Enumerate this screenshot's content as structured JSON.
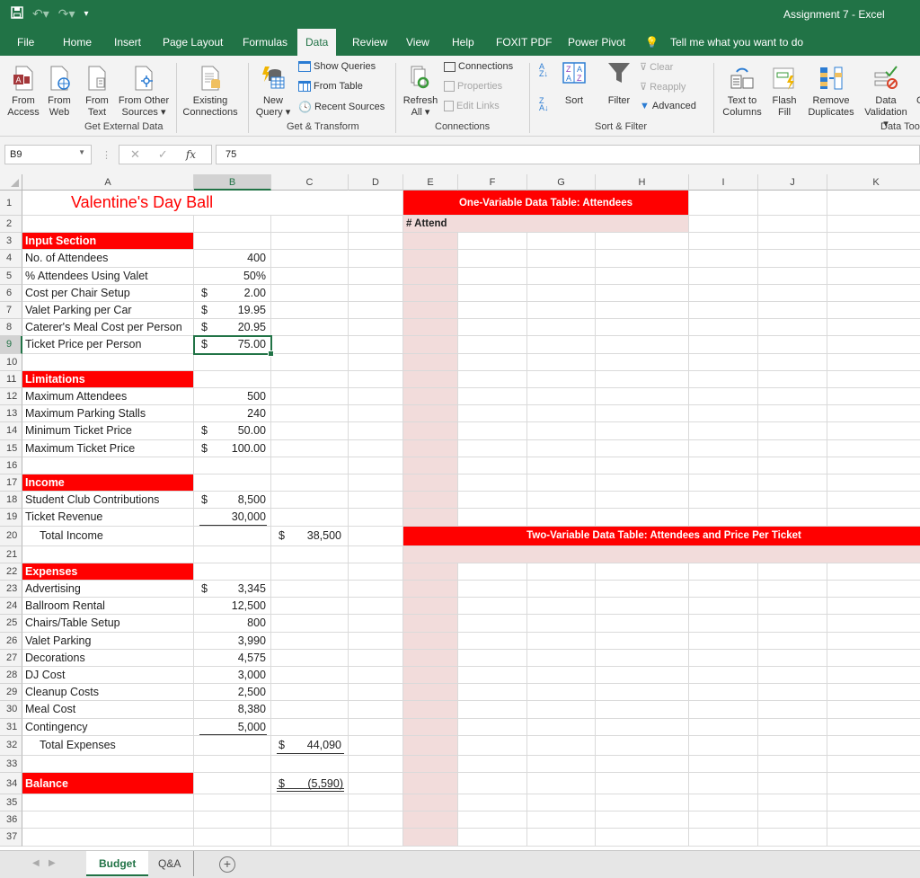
{
  "window": {
    "title": "Assignment 7  -  Excel",
    "qat": {
      "save_icon": "save-icon",
      "undo_icon": "undo-icon",
      "redo_icon": "redo-icon",
      "customize_icon": "customize-qat-icon"
    }
  },
  "ribbon_tabs": [
    {
      "label": "File"
    },
    {
      "label": "Home"
    },
    {
      "label": "Insert"
    },
    {
      "label": "Page Layout"
    },
    {
      "label": "Formulas"
    },
    {
      "label": "Data",
      "active": true
    },
    {
      "label": "Review"
    },
    {
      "label": "View"
    },
    {
      "label": "Help"
    },
    {
      "label": "FOXIT PDF"
    },
    {
      "label": "Power Pivot"
    }
  ],
  "tell_me": "Tell me what you want to do",
  "ribbon": {
    "get_external_data": {
      "label": "Get External Data",
      "buttons": [
        {
          "line1": "From",
          "line2": "Access"
        },
        {
          "line1": "From",
          "line2": "Web"
        },
        {
          "line1": "From",
          "line2": "Text"
        },
        {
          "line1": "From Other",
          "line2": "Sources ▾"
        },
        {
          "line1": "Existing",
          "line2": "Connections"
        }
      ]
    },
    "get_transform": {
      "label": "Get & Transform",
      "new_query": {
        "line1": "New",
        "line2": "Query ▾"
      },
      "show_queries": "Show Queries",
      "from_table": "From Table",
      "recent_sources": "Recent Sources"
    },
    "connections": {
      "label": "Connections",
      "refresh_all": {
        "line1": "Refresh",
        "line2": "All ▾"
      },
      "connections": "Connections",
      "properties": "Properties",
      "edit_links": "Edit Links"
    },
    "sort_filter": {
      "label": "Sort & Filter",
      "sort": "Sort",
      "filter": "Filter",
      "clear": "Clear",
      "reapply": "Reapply",
      "advanced": "Advanced"
    },
    "data_tools": {
      "label": "Data Too",
      "buttons": [
        {
          "line1": "Text to",
          "line2": "Columns"
        },
        {
          "line1": "Flash",
          "line2": "Fill"
        },
        {
          "line1": "Remove",
          "line2": "Duplicates"
        },
        {
          "line1": "Data",
          "line2": "Validation ▾"
        },
        {
          "line1": "C",
          "line2": ""
        }
      ]
    }
  },
  "formula_bar": {
    "name_box": "B9",
    "formula": "75"
  },
  "columns": [
    "A",
    "B",
    "C",
    "D",
    "E",
    "F",
    "G",
    "H",
    "I",
    "J",
    "K"
  ],
  "selected_column": "B",
  "selected_row": "9",
  "rows": [
    "1",
    "2",
    "3",
    "4",
    "5",
    "6",
    "7",
    "8",
    "9",
    "10",
    "11",
    "12",
    "13",
    "14",
    "15",
    "16",
    "17",
    "18",
    "19",
    "20",
    "21",
    "22",
    "23",
    "24",
    "25",
    "26",
    "27",
    "28",
    "29",
    "30",
    "31",
    "32",
    "33",
    "34",
    "35",
    "36",
    "37"
  ],
  "sheet": {
    "title": "Valentine's Day Ball",
    "input_section": {
      "header": "Input Section",
      "items": [
        {
          "label": "No. of Attendees",
          "currency": "",
          "value": "400"
        },
        {
          "label": "% Attendees Using Valet",
          "currency": "",
          "value": "50%"
        },
        {
          "label": "Cost per Chair Setup",
          "currency": "$",
          "value": "2.00"
        },
        {
          "label": "Valet Parking per Car",
          "currency": "$",
          "value": "19.95"
        },
        {
          "label": "Caterer's Meal Cost per Person",
          "currency": "$",
          "value": "20.95"
        },
        {
          "label": "Ticket Price per Person",
          "currency": "$",
          "value": "75.00"
        }
      ]
    },
    "limitations": {
      "header": "Limitations",
      "items": [
        {
          "label": "Maximum Attendees",
          "currency": "",
          "value": "500"
        },
        {
          "label": "Maximum Parking Stalls",
          "currency": "",
          "value": "240"
        },
        {
          "label": "Minimum Ticket Price",
          "currency": "$",
          "value": "50.00"
        },
        {
          "label": "Maximum Ticket Price",
          "currency": "$",
          "value": "100.00"
        }
      ]
    },
    "income": {
      "header": "Income",
      "items": [
        {
          "label": "Student Club Contributions",
          "currency": "$",
          "value": "8,500"
        },
        {
          "label": "Ticket Revenue",
          "currency": "",
          "value": "30,000"
        }
      ],
      "total_label": "Total Income",
      "total_currency": "$",
      "total_value": "38,500"
    },
    "expenses": {
      "header": "Expenses",
      "items": [
        {
          "label": "Advertising",
          "currency": "$",
          "value": "3,345"
        },
        {
          "label": "Ballroom Rental",
          "currency": "",
          "value": "12,500"
        },
        {
          "label": "Chairs/Table Setup",
          "currency": "",
          "value": "800"
        },
        {
          "label": "Valet Parking",
          "currency": "",
          "value": "3,990"
        },
        {
          "label": "Decorations",
          "currency": "",
          "value": "4,575"
        },
        {
          "label": "DJ Cost",
          "currency": "",
          "value": "3,000"
        },
        {
          "label": "Cleanup Costs",
          "currency": "",
          "value": "2,500"
        },
        {
          "label": "Meal Cost",
          "currency": "",
          "value": "8,380"
        },
        {
          "label": "Contingency",
          "currency": "",
          "value": "5,000"
        }
      ],
      "total_label": "Total Expenses",
      "total_currency": "$",
      "total_value": "44,090"
    },
    "balance": {
      "label": "Balance",
      "currency": "$",
      "value": "(5,590)"
    },
    "one_var_table": {
      "title": "One-Variable Data Table: Attendees",
      "col_header": "# Attend"
    },
    "two_var_table": {
      "title": "Two-Variable Data Table: Attendees and Price Per Ticket"
    }
  },
  "sheet_tabs": [
    {
      "label": "Budget",
      "active": true
    },
    {
      "label": "Q&A",
      "active": false
    }
  ],
  "colors": {
    "excel_green": "#217346",
    "section_red": "#ff0000",
    "table_pink": "#f2dcdb"
  }
}
